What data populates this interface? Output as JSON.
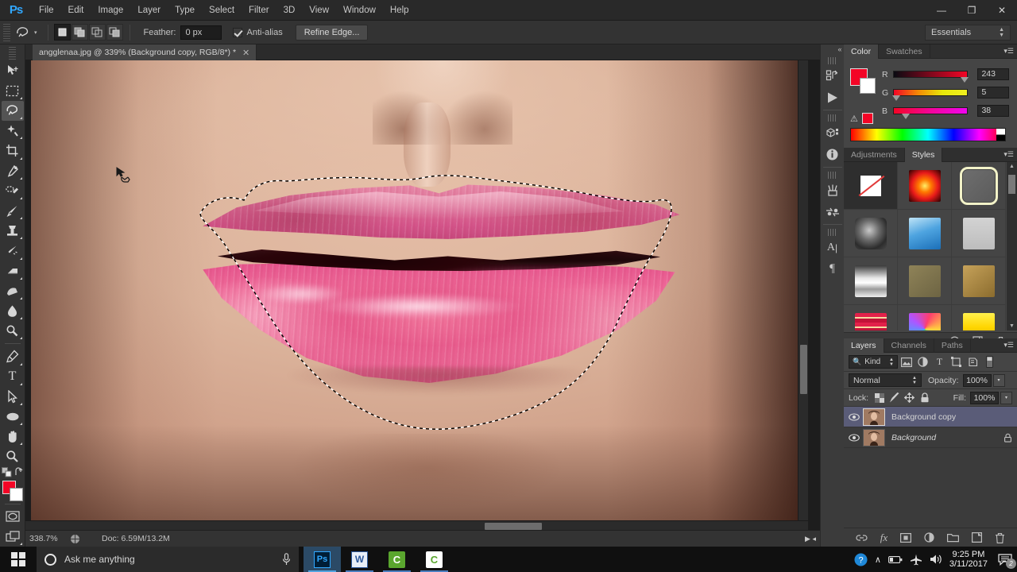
{
  "app": {
    "name": "Adobe Photoshop",
    "logo_text": "Ps"
  },
  "menubar": {
    "items": [
      {
        "label": "File"
      },
      {
        "label": "Edit"
      },
      {
        "label": "Image"
      },
      {
        "label": "Layer"
      },
      {
        "label": "Type"
      },
      {
        "label": "Select"
      },
      {
        "label": "Filter"
      },
      {
        "label": "3D"
      },
      {
        "label": "View"
      },
      {
        "label": "Window"
      },
      {
        "label": "Help"
      }
    ]
  },
  "window_controls": {
    "minimize": "—",
    "restore": "❐",
    "close": "✕"
  },
  "options_bar": {
    "tool": "lasso-tool",
    "selection_modes": [
      {
        "name": "new-selection",
        "active": true
      },
      {
        "name": "add-to-selection",
        "active": false
      },
      {
        "name": "subtract-from-selection",
        "active": false
      },
      {
        "name": "intersect-with-selection",
        "active": false
      }
    ],
    "feather_label": "Feather:",
    "feather_value": "0 px",
    "antialias_label": "Anti-alias",
    "antialias_checked": true,
    "refine_edge_label": "Refine Edge...",
    "workspace": "Essentials"
  },
  "toolbar": {
    "tools": [
      {
        "name": "move-tool",
        "active": false
      },
      {
        "name": "rectangular-marquee-tool",
        "active": false
      },
      {
        "name": "lasso-tool",
        "active": true
      },
      {
        "name": "quick-selection-tool",
        "active": false
      },
      {
        "name": "crop-tool",
        "active": false
      },
      {
        "name": "eyedropper-tool",
        "active": false
      },
      {
        "name": "spot-healing-brush-tool",
        "active": false
      },
      {
        "name": "brush-tool",
        "active": false
      },
      {
        "name": "clone-stamp-tool",
        "active": false
      },
      {
        "name": "history-brush-tool",
        "active": false
      },
      {
        "name": "eraser-tool",
        "active": false
      },
      {
        "name": "gradient-tool",
        "active": false
      },
      {
        "name": "blur-tool",
        "active": false
      },
      {
        "name": "dodge-tool",
        "active": false
      },
      {
        "name": "pen-tool",
        "active": false
      },
      {
        "name": "horizontal-type-tool",
        "active": false
      },
      {
        "name": "path-selection-tool",
        "active": false
      },
      {
        "name": "ellipse-tool",
        "active": false
      },
      {
        "name": "hand-tool",
        "active": false
      },
      {
        "name": "zoom-tool",
        "active": false
      }
    ],
    "foreground_color": "#f30526",
    "background_color": "#ffffff"
  },
  "document": {
    "tab_title": "angglenaa.jpg @ 339% (Background copy, RGB/8*) *",
    "close_label": "✕"
  },
  "status_bar": {
    "zoom": "338.7%",
    "doc_info": "Doc: 6.59M/13.2M"
  },
  "icon_dock": {
    "collapse_label": "«",
    "items": [
      {
        "name": "history-icon"
      },
      {
        "name": "actions-play-icon"
      },
      {
        "name": "3d-icon"
      },
      {
        "name": "info-icon"
      },
      {
        "name": "brush-presets-icon"
      },
      {
        "name": "clone-source-icon"
      },
      {
        "name": "character-icon"
      },
      {
        "name": "paragraph-icon"
      }
    ]
  },
  "color_panel": {
    "tabs": [
      {
        "label": "Color",
        "active": true
      },
      {
        "label": "Swatches",
        "active": false
      }
    ],
    "foreground_color": "#f30526",
    "background_color": "#ffffff",
    "channels": [
      {
        "label": "R",
        "value": "243",
        "pos": 95
      },
      {
        "label": "G",
        "value": "5",
        "pos": 2
      },
      {
        "label": "B",
        "value": "38",
        "pos": 15
      }
    ],
    "out_of_gamut_color": "#f30526"
  },
  "styles_panel": {
    "tabs": [
      {
        "label": "Adjustments",
        "active": false
      },
      {
        "label": "Styles",
        "active": true
      }
    ],
    "swatches": [
      {
        "name": "style-none",
        "kind": "none",
        "selected": false
      },
      {
        "name": "style-red-glow",
        "kind": "grad",
        "css": "radial-gradient(circle at 50% 50%, #ffee66 0%, #ff7a00 28%, #e81a1a 58%, #2a0000 100%)",
        "selected": false
      },
      {
        "name": "style-gray-rounded",
        "kind": "grad",
        "css": "linear-gradient(135deg,#6e6e6e,#5b5b5b)",
        "selected": true
      },
      {
        "name": "style-dark-button",
        "kind": "grad",
        "css": "radial-gradient(circle at 45% 40%, #c9c9c9 0%, #6b6b6b 38%, #2c2c2c 72%, #494949 100%)",
        "selected": false
      },
      {
        "name": "style-sky-blue",
        "kind": "grad",
        "css": "linear-gradient(160deg,#bfe4f7 0%, #4ea4e0 45%, #1b6fb8 100%)",
        "selected": false
      },
      {
        "name": "style-light-gray",
        "kind": "grad",
        "css": "linear-gradient(180deg,#d3d3d3,#bdbdbd)",
        "selected": false
      },
      {
        "name": "style-chrome",
        "kind": "grad",
        "css": "linear-gradient(180deg,#3a3a3a 0%, #e8e8e8 40%, #ffffff 55%, #9a9a9a 75%, #efefef 100%)",
        "selected": false
      },
      {
        "name": "style-khaki",
        "kind": "grad",
        "css": "linear-gradient(140deg,#8f8358,#6d6443)",
        "selected": false
      },
      {
        "name": "style-gold-tan",
        "kind": "grad",
        "css": "linear-gradient(140deg,#c6a25a,#8b6c2e)",
        "selected": false
      },
      {
        "name": "style-red-stripes",
        "kind": "grad",
        "css": "repeating-linear-gradient(180deg,#e2214a 0 5px,#f7d8a0 5px 7px,#c21338 7px 12px)",
        "selected": false
      },
      {
        "name": "style-rainbow-marble",
        "kind": "grad",
        "css": "conic-gradient(from 20deg,#ff3d6e,#ffd23d,#4fd96b,#3da8ff,#b054ff,#ff3d6e)",
        "selected": false
      },
      {
        "name": "style-yellow-bevel",
        "kind": "grad",
        "css": "linear-gradient(180deg,#fff04d 0%, #ffd500 45%, #c9a200 100%)",
        "selected": false
      }
    ],
    "footer_icons": [
      {
        "name": "clear-style-icon"
      },
      {
        "name": "new-style-icon"
      },
      {
        "name": "delete-style-icon"
      }
    ]
  },
  "layers_panel": {
    "tabs": [
      {
        "label": "Layers",
        "active": true
      },
      {
        "label": "Channels",
        "active": false
      },
      {
        "label": "Paths",
        "active": false
      }
    ],
    "filter_kind_label": "Kind",
    "filter_icons": [
      {
        "name": "filter-pixel-icon"
      },
      {
        "name": "filter-adjustment-icon"
      },
      {
        "name": "filter-type-icon"
      },
      {
        "name": "filter-shape-icon"
      },
      {
        "name": "filter-smart-object-icon"
      },
      {
        "name": "filter-toggle-icon"
      }
    ],
    "blend_mode": "Normal",
    "opacity_label": "Opacity:",
    "opacity_value": "100%",
    "lock_label": "Lock:",
    "lock_icons": [
      {
        "name": "lock-transparent-pixels-icon"
      },
      {
        "name": "lock-image-pixels-icon"
      },
      {
        "name": "lock-position-icon"
      },
      {
        "name": "lock-all-icon"
      }
    ],
    "fill_label": "Fill:",
    "fill_value": "100%",
    "layers": [
      {
        "name": "Background copy",
        "selected": true,
        "locked": false,
        "visible": true,
        "italic": false
      },
      {
        "name": "Background",
        "selected": false,
        "locked": true,
        "visible": true,
        "italic": true
      }
    ],
    "footer_icons": [
      {
        "name": "link-layers-icon"
      },
      {
        "name": "layer-style-fx-icon"
      },
      {
        "name": "add-layer-mask-icon"
      },
      {
        "name": "new-adjustment-layer-icon"
      },
      {
        "name": "new-group-icon"
      },
      {
        "name": "new-layer-icon"
      },
      {
        "name": "delete-layer-icon"
      }
    ]
  },
  "taskbar": {
    "start_label": "start-button",
    "search_placeholder": "Ask me anything",
    "mic_label": "microphone-icon",
    "apps": [
      {
        "name": "taskbar-photoshop",
        "label": "Ps",
        "active": true
      },
      {
        "name": "taskbar-word",
        "label": "W",
        "active": false
      },
      {
        "name": "taskbar-camtasia-editor",
        "label": "C",
        "active": false
      },
      {
        "name": "taskbar-camtasia-recorder",
        "label": "C",
        "active": false
      }
    ],
    "tray": {
      "help_label": "?",
      "chevron_label": "∧",
      "battery_label": "battery-icon",
      "airplane_label": "airplane-mode-icon",
      "volume_label": "volume-icon",
      "time": "9:25 PM",
      "date": "3/11/2017",
      "notification_count": "2"
    }
  },
  "canvas": {
    "subject": "close-up of lips with active lasso selection",
    "selection_active": true
  }
}
